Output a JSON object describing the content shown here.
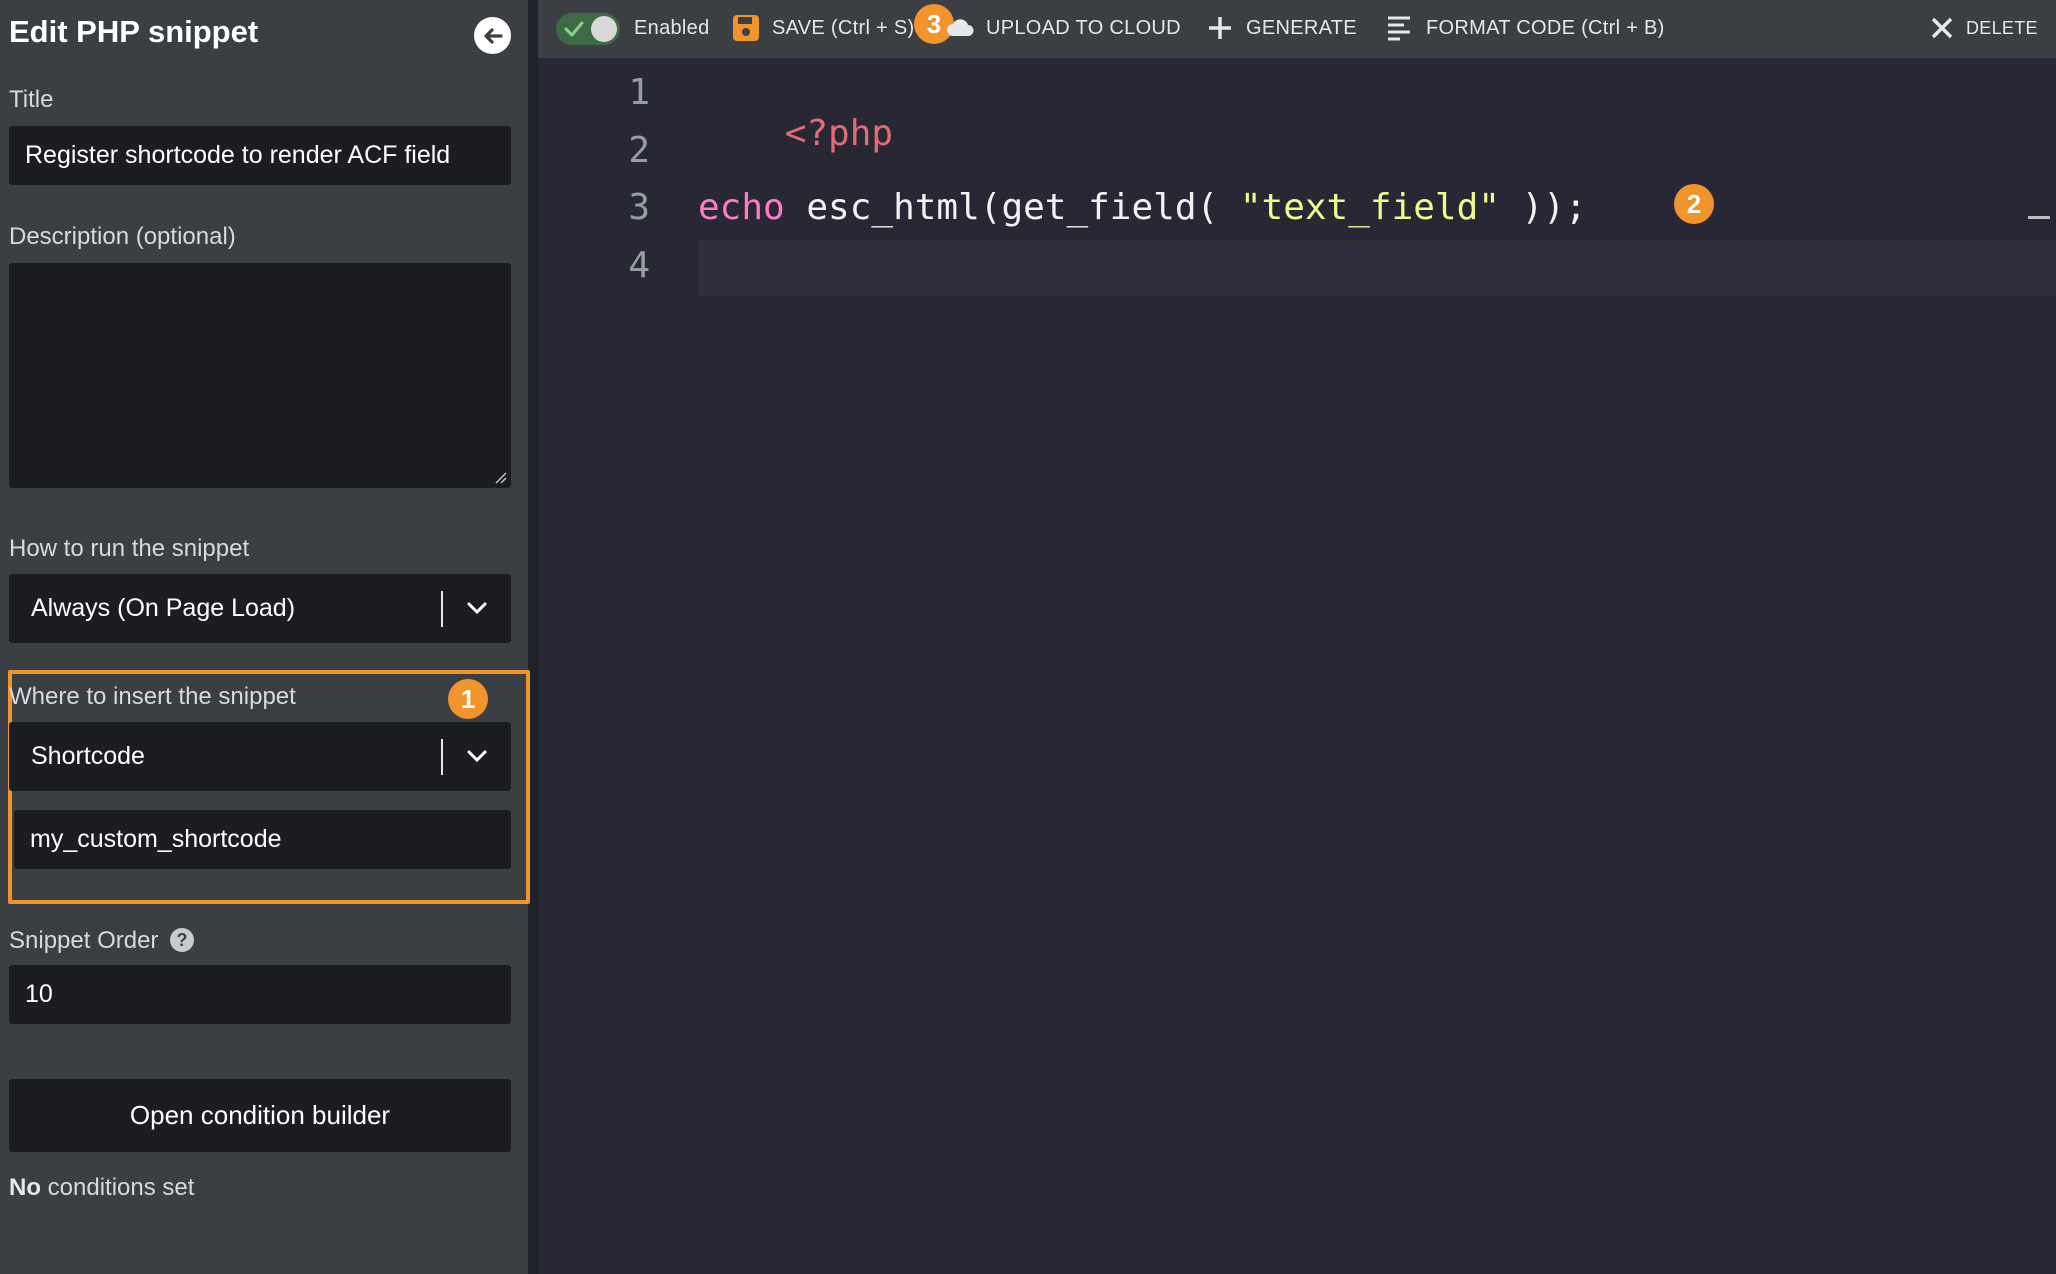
{
  "sidebar": {
    "title": "Edit PHP snippet",
    "title_label": "Title",
    "title_value": "Register shortcode to render ACF field",
    "description_label": "Description (optional)",
    "description_value": "",
    "run_label": "How to run the snippet",
    "run_value": "Always (On Page Load)",
    "insert_label": "Where to insert the snippet",
    "insert_value": "Shortcode",
    "shortcode_value": "my_custom_shortcode",
    "order_label": "Snippet Order",
    "order_help": "?",
    "order_value": "10",
    "condition_button": "Open condition builder",
    "conditions_prefix": "No",
    "conditions_suffix": " conditions set"
  },
  "toolbar": {
    "enabled_label": "Enabled",
    "enabled": true,
    "save_label": "SAVE (Ctrl + S)",
    "upload_label": "UPLOAD TO CLOUD",
    "generate_label": "GENERATE",
    "format_label": "FORMAT CODE (Ctrl + B)",
    "delete_label": "DELETE"
  },
  "editor": {
    "line_numbers": [
      "1",
      "2",
      "3",
      "4"
    ],
    "line1": "<?php",
    "line3_keyword": "echo",
    "line3_call": " esc_html(get_field( ",
    "line3_string": "\"text_field\"",
    "line3_end": " ));"
  },
  "annotations": {
    "badge_1": "1",
    "badge_2": "2",
    "badge_3": "3",
    "color": "#f0942b"
  },
  "icons": [
    "arrow-left-icon",
    "check-icon",
    "save-icon",
    "cloud-upload-icon",
    "plus-icon",
    "format-lines-icon",
    "close-icon",
    "chevron-down-icon",
    "help-icon"
  ]
}
